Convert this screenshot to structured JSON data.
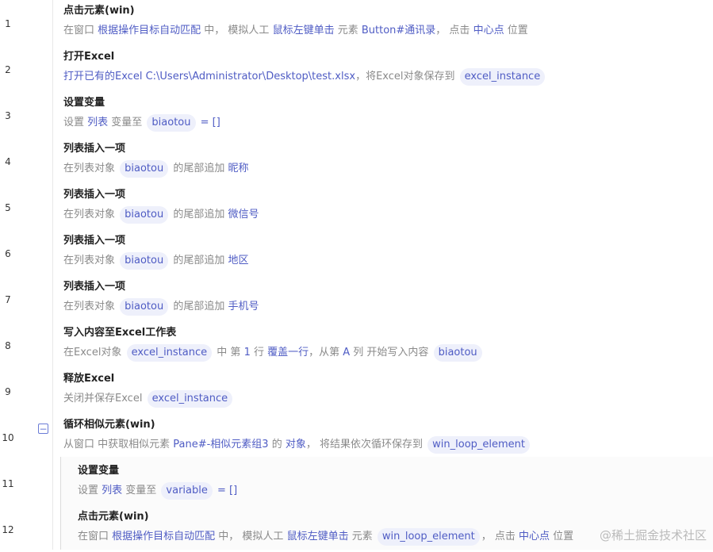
{
  "rows": [
    {
      "num": "1",
      "title": "点击元素(win)",
      "d": [
        "在窗口 ",
        "根据操作目标自动匹配",
        " 中， 模拟人工 ",
        "鼠标左键单击",
        " 元素 ",
        "Button#通讯录",
        "， 点击 ",
        "中心点",
        " 位置"
      ]
    },
    {
      "num": "2",
      "title": "打开Excel",
      "d": [
        "打开已有的Excel C:\\Users\\Administrator\\Desktop\\test.xlsx",
        "，将Excel对象保存到 ",
        "excel_instance"
      ]
    },
    {
      "num": "3",
      "title": "设置变量",
      "d": [
        "设置 ",
        "列表",
        " 变量至 ",
        "biaotou",
        " = []"
      ]
    },
    {
      "num": "4",
      "title": "列表插入一项",
      "d": [
        "在列表对象 ",
        "biaotou",
        " 的尾部追加 ",
        "昵称"
      ]
    },
    {
      "num": "5",
      "title": "列表插入一项",
      "d": [
        "在列表对象 ",
        "biaotou",
        " 的尾部追加 ",
        "微信号"
      ]
    },
    {
      "num": "6",
      "title": "列表插入一项",
      "d": [
        "在列表对象 ",
        "biaotou",
        " 的尾部追加 ",
        "地区"
      ]
    },
    {
      "num": "7",
      "title": "列表插入一项",
      "d": [
        "在列表对象 ",
        "biaotou",
        " 的尾部追加 ",
        "手机号"
      ]
    },
    {
      "num": "8",
      "title": "写入内容至Excel工作表",
      "d": [
        "在Excel对象 ",
        "excel_instance",
        " 中 第 ",
        "1",
        " 行 ",
        "覆盖一行",
        "，从第 ",
        "A",
        " 列 开始写入内容 ",
        "biaotou"
      ]
    },
    {
      "num": "9",
      "title": "释放Excel",
      "d": [
        "关闭并保存Excel ",
        "excel_instance"
      ]
    },
    {
      "num": "10",
      "title": "循环相似元素(win)",
      "d": [
        "从窗口 中获取相似元素 ",
        "Pane#-相似元素组3",
        " 的 ",
        "对象",
        "， 将结果依次循环保存到 ",
        "win_loop_element"
      ]
    },
    {
      "num": "11",
      "title": "设置变量",
      "d": [
        "设置 ",
        "列表",
        " 变量至 ",
        "variable",
        " = []"
      ]
    },
    {
      "num": "12",
      "title": "点击元素(win)",
      "d": [
        "在窗口 ",
        "根据操作目标自动匹配",
        " 中， 模拟人工 ",
        "鼠标左键单击",
        " 元素 ",
        "win_loop_element",
        "， 点击 ",
        "中心点",
        " 位置"
      ]
    }
  ],
  "collapse_symbol": "−",
  "watermark": "@稀土掘金技术社区"
}
